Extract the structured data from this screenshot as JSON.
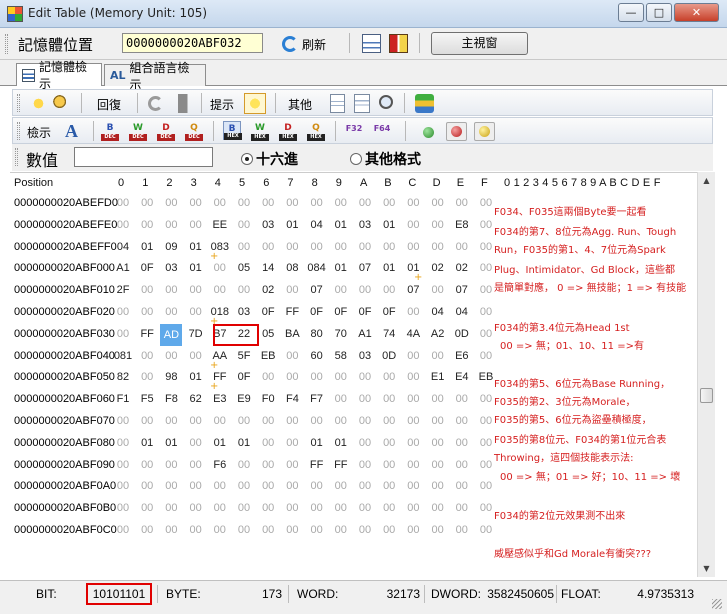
{
  "window": {
    "title": "Edit Table (Memory Unit: 105)"
  },
  "address_bar": {
    "label": "記憶體位置",
    "value": "0000000020ABF032",
    "refresh_label": "刷新",
    "main_window_label": "主視窗"
  },
  "tabs": [
    {
      "label": "記憶體檢示",
      "active": true
    },
    {
      "label": "組合語言檢示",
      "active": false
    }
  ],
  "toolbar1": {
    "restore_label": "回復",
    "hint_label": "提示",
    "other_label": "其他"
  },
  "toolbar2": {
    "view_label": "檢示",
    "format_badges": [
      "DEC",
      "DEC",
      "DEC",
      "DEC",
      "HEX",
      "HEX",
      "HEX",
      "HEX"
    ],
    "format_letters": [
      "B",
      "W",
      "D",
      "Q",
      "B",
      "W",
      "D",
      "Q"
    ],
    "float_letters": [
      "F32",
      "F64"
    ]
  },
  "value_row": {
    "label": "數值",
    "input_value": "",
    "hex_label": "十六進",
    "other_format_label": "其他格式",
    "selected": "hex"
  },
  "grid": {
    "position_header": "Position",
    "col_headers": [
      "0",
      "1",
      "2",
      "3",
      "4",
      "5",
      "6",
      "7",
      "8",
      "9",
      "A",
      "B",
      "C",
      "D",
      "E",
      "F"
    ],
    "ascii_header": "0 1 2 3 4 5 6 7 8 9 A B C D E F",
    "rows": [
      {
        "addr": "0000000020ABEFD0",
        "cells": [
          "00",
          "00",
          "00",
          "00",
          "00",
          "00",
          "00",
          "00",
          "00",
          "00",
          "00",
          "00",
          "00",
          "00",
          "00",
          "00"
        ]
      },
      {
        "addr": "0000000020ABEFE0",
        "cells": [
          "00",
          "00",
          "00",
          "00",
          "EE",
          "00",
          "03",
          "01",
          "04",
          "01",
          "03",
          "01",
          "00",
          "00",
          "E8",
          "00"
        ]
      },
      {
        "addr": "0000000020ABEFF0",
        "cells": [
          "04",
          "01",
          "09",
          "01",
          "083",
          "00",
          "00",
          "00",
          "00",
          "00",
          "00",
          "00",
          "00",
          "00",
          "00",
          "00"
        ]
      },
      {
        "addr": "0000000020ABF000",
        "cells": [
          "A1",
          "0F",
          "03",
          "01",
          "00",
          "05",
          "14",
          "08",
          "084",
          "01",
          "07",
          "01",
          "01",
          "02",
          "02",
          "00"
        ]
      },
      {
        "addr": "0000000020ABF010",
        "cells": [
          "2F",
          "00",
          "00",
          "00",
          "00",
          "00",
          "02",
          "00",
          "07",
          "00",
          "00",
          "00",
          "07",
          "00",
          "07",
          "00"
        ]
      },
      {
        "addr": "0000000020ABF020",
        "cells": [
          "00",
          "00",
          "00",
          "00",
          "018",
          "03",
          "0F",
          "FF",
          "0F",
          "0F",
          "0F",
          "0F",
          "00",
          "04",
          "04",
          "00"
        ]
      },
      {
        "addr": "0000000020ABF030",
        "cells": [
          "00",
          "FF",
          "AD",
          "7D",
          "B7",
          "22",
          "05",
          "BA",
          "80",
          "70",
          "A1",
          "74",
          "4A",
          "A2",
          "0D",
          "00"
        ]
      },
      {
        "addr": "0000000020ABF040",
        "cells": [
          "081",
          "00",
          "00",
          "00",
          "AA",
          "5F",
          "EB",
          "00",
          "60",
          "58",
          "03",
          "0D",
          "00",
          "00",
          "E6",
          "00"
        ]
      },
      {
        "addr": "0000000020ABF050",
        "cells": [
          "82",
          "00",
          "98",
          "01",
          "FF",
          "0F",
          "00",
          "00",
          "00",
          "00",
          "00",
          "00",
          "00",
          "E1",
          "E4",
          "EB"
        ]
      },
      {
        "addr": "0000000020ABF060",
        "cells": [
          "F1",
          "F5",
          "F8",
          "62",
          "E3",
          "E9",
          "F0",
          "F4",
          "F7",
          "00",
          "00",
          "00",
          "00",
          "00",
          "00",
          "00"
        ]
      },
      {
        "addr": "0000000020ABF070",
        "cells": [
          "00",
          "00",
          "00",
          "00",
          "00",
          "00",
          "00",
          "00",
          "00",
          "00",
          "00",
          "00",
          "00",
          "00",
          "00",
          "00"
        ]
      },
      {
        "addr": "0000000020ABF080",
        "cells": [
          "00",
          "01",
          "01",
          "00",
          "01",
          "01",
          "00",
          "00",
          "01",
          "01",
          "00",
          "00",
          "00",
          "00",
          "00",
          "00"
        ]
      },
      {
        "addr": "0000000020ABF090",
        "cells": [
          "00",
          "00",
          "00",
          "00",
          "F6",
          "00",
          "00",
          "00",
          "FF",
          "FF",
          "00",
          "00",
          "00",
          "00",
          "00",
          "00"
        ]
      },
      {
        "addr": "0000000020ABF0A0",
        "cells": [
          "00",
          "00",
          "00",
          "00",
          "00",
          "00",
          "00",
          "00",
          "00",
          "00",
          "00",
          "00",
          "00",
          "00",
          "00",
          "00"
        ]
      },
      {
        "addr": "0000000020ABF0B0",
        "cells": [
          "00",
          "00",
          "00",
          "00",
          "00",
          "00",
          "00",
          "00",
          "00",
          "00",
          "00",
          "00",
          "00",
          "00",
          "00",
          "00"
        ]
      },
      {
        "addr": "0000000020ABF0C0",
        "cells": [
          "00",
          "00",
          "00",
          "00",
          "00",
          "00",
          "00",
          "00",
          "00",
          "00",
          "00",
          "00",
          "00",
          "00",
          "00",
          "00"
        ]
      }
    ],
    "selected_cell": "AD",
    "highlighted_bytes": [
      "B7",
      "22"
    ]
  },
  "annotations": [
    "F034、F035這兩個Byte要一起看",
    "F034的第7、8位元為Agg. Run、Tough",
    "Run，F035的第1、4、7位元為Spark",
    "Plug、Intimidator、Gd Block，這些都",
    "是簡單對應， 0 => 無技能；1 => 有技能",
    "F034的第3.4位元為Head 1st",
    "00 => 無；01、10、11 =>有",
    "F034的第5、6位元為Base Running，",
    "F035的第2、3位元為Morale，",
    "F035的第5、6位元為盜壘積極度，",
    "F035的第8位元、F034的第1位元合表",
    "Throwing，這四個技能表示法:",
    "00 => 無；01 => 好；10、11 => 壞",
    "F034的第2位元效果測不出來",
    "威壓感似乎和Gd Morale有衝突???"
  ],
  "status": {
    "bit_label": "BIT:",
    "bit_value": "10101101",
    "byte_label": "BYTE:",
    "byte_value": "173",
    "word_label": "WORD:",
    "word_value": "32173",
    "dword_label": "DWORD:",
    "dword_value": "3582450605",
    "float_label": "FLOAT:",
    "float_value": "4.9735313"
  },
  "colors": {
    "annotation": "#d51f1f",
    "highlight_box": "#e00000",
    "selection": "#5fa9ea",
    "address_input_bg": "#ffffd4"
  }
}
